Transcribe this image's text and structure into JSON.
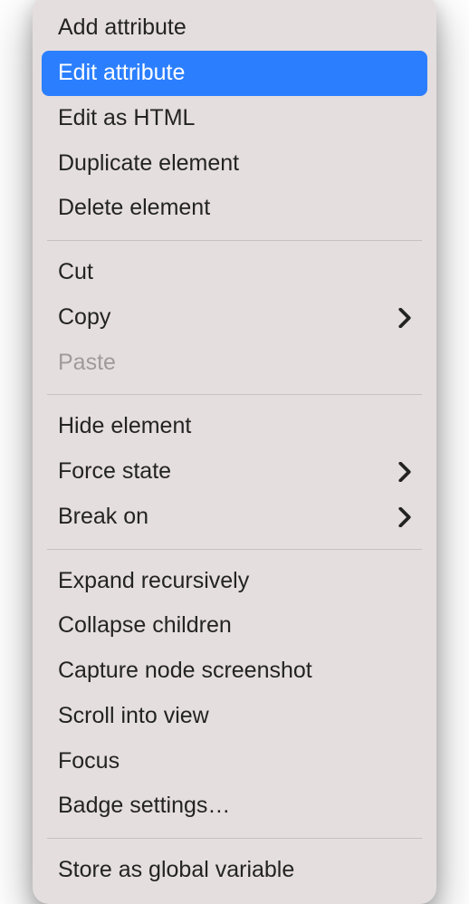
{
  "menu": {
    "colors": {
      "background": "#e5dede",
      "highlight": "#2b7fff",
      "text": "#232323",
      "disabledText": "#a09a9a",
      "separator": "#c7c0c0"
    },
    "groups": [
      {
        "items": [
          {
            "id": "add-attribute",
            "label": "Add attribute",
            "hasSubmenu": false,
            "highlighted": false,
            "disabled": false
          },
          {
            "id": "edit-attribute",
            "label": "Edit attribute",
            "hasSubmenu": false,
            "highlighted": true,
            "disabled": false
          },
          {
            "id": "edit-as-html",
            "label": "Edit as HTML",
            "hasSubmenu": false,
            "highlighted": false,
            "disabled": false
          },
          {
            "id": "duplicate-element",
            "label": "Duplicate element",
            "hasSubmenu": false,
            "highlighted": false,
            "disabled": false
          },
          {
            "id": "delete-element",
            "label": "Delete element",
            "hasSubmenu": false,
            "highlighted": false,
            "disabled": false
          }
        ]
      },
      {
        "items": [
          {
            "id": "cut",
            "label": "Cut",
            "hasSubmenu": false,
            "highlighted": false,
            "disabled": false
          },
          {
            "id": "copy",
            "label": "Copy",
            "hasSubmenu": true,
            "highlighted": false,
            "disabled": false
          },
          {
            "id": "paste",
            "label": "Paste",
            "hasSubmenu": false,
            "highlighted": false,
            "disabled": true
          }
        ]
      },
      {
        "items": [
          {
            "id": "hide-element",
            "label": "Hide element",
            "hasSubmenu": false,
            "highlighted": false,
            "disabled": false
          },
          {
            "id": "force-state",
            "label": "Force state",
            "hasSubmenu": true,
            "highlighted": false,
            "disabled": false
          },
          {
            "id": "break-on",
            "label": "Break on",
            "hasSubmenu": true,
            "highlighted": false,
            "disabled": false
          }
        ]
      },
      {
        "items": [
          {
            "id": "expand-recursively",
            "label": "Expand recursively",
            "hasSubmenu": false,
            "highlighted": false,
            "disabled": false
          },
          {
            "id": "collapse-children",
            "label": "Collapse children",
            "hasSubmenu": false,
            "highlighted": false,
            "disabled": false
          },
          {
            "id": "capture-node-screenshot",
            "label": "Capture node screenshot",
            "hasSubmenu": false,
            "highlighted": false,
            "disabled": false
          },
          {
            "id": "scroll-into-view",
            "label": "Scroll into view",
            "hasSubmenu": false,
            "highlighted": false,
            "disabled": false
          },
          {
            "id": "focus",
            "label": "Focus",
            "hasSubmenu": false,
            "highlighted": false,
            "disabled": false
          },
          {
            "id": "badge-settings",
            "label": "Badge settings…",
            "hasSubmenu": false,
            "highlighted": false,
            "disabled": false
          }
        ]
      },
      {
        "items": [
          {
            "id": "store-as-global-variable",
            "label": "Store as global variable",
            "hasSubmenu": false,
            "highlighted": false,
            "disabled": false
          }
        ]
      }
    ]
  }
}
